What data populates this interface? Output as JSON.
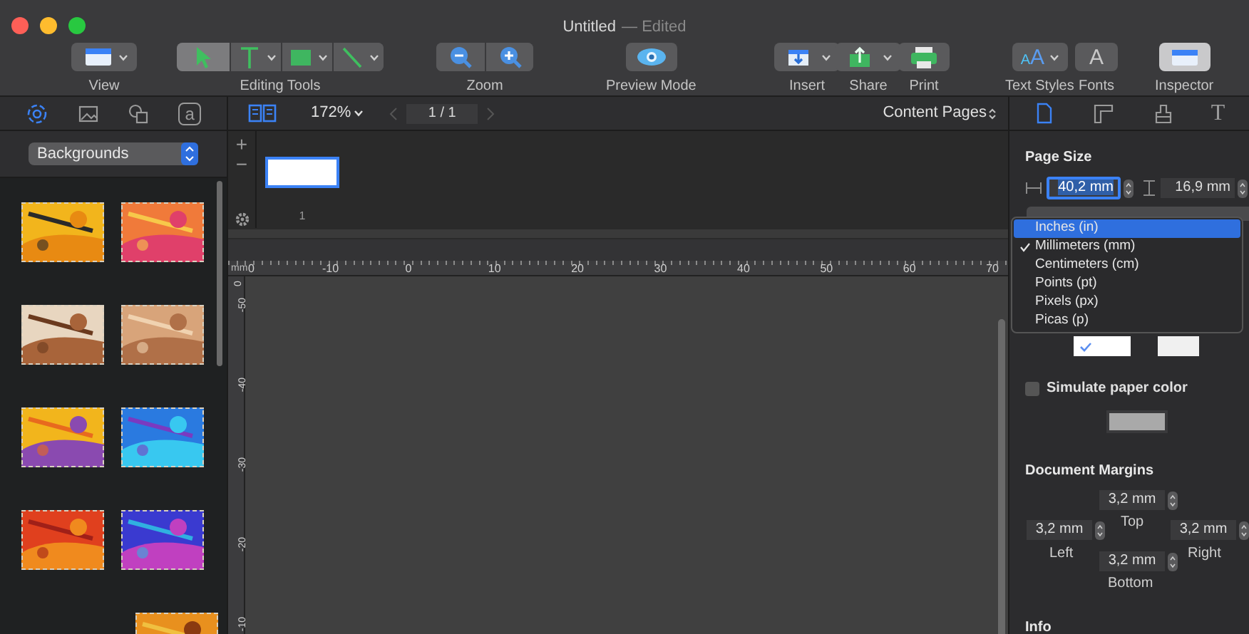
{
  "window": {
    "title": "Untitled",
    "subtitle": "— Edited"
  },
  "toolbar": [
    {
      "kind": "button",
      "label": "View",
      "menu": true,
      "selected": false
    },
    {
      "kind": "segmented",
      "label": "Editing Tools",
      "segments": [
        {
          "menu": false,
          "selected": true
        },
        {
          "menu": true,
          "selected": false
        },
        {
          "menu": true,
          "selected": false
        },
        {
          "menu": true,
          "selected": false
        }
      ]
    },
    {
      "kind": "segmented",
      "label": "Zoom",
      "segments": [
        {
          "menu": false,
          "selected": false
        },
        {
          "menu": false,
          "selected": false
        }
      ]
    },
    {
      "kind": "button",
      "label": "Preview Mode",
      "menu": false,
      "selected": false
    },
    {
      "kind": "button",
      "label": "Insert",
      "menu": true,
      "selected": false
    },
    {
      "kind": "button",
      "label": "Share",
      "menu": true,
      "selected": false
    },
    {
      "kind": "button",
      "label": "Print",
      "menu": false,
      "selected": false
    },
    {
      "kind": "button",
      "label": "Text Styles",
      "menu": true,
      "selected": false,
      "glyphs": [
        "A",
        "A"
      ]
    },
    {
      "kind": "button",
      "label": "Fonts",
      "menu": false,
      "selected": false,
      "glyphs": [
        "A"
      ]
    },
    {
      "kind": "button",
      "label": "Inspector",
      "menu": false,
      "selected": true
    }
  ],
  "library": {
    "tabs": [
      {
        "selected": true
      },
      {
        "selected": false
      },
      {
        "selected": false
      },
      {
        "selected": false,
        "glyph": "a"
      }
    ],
    "category": "Backgrounds"
  },
  "canvas_bar": {
    "zoom": "172%",
    "page": "1 / 1",
    "pages_menu": "Content Pages"
  },
  "page_strip": {
    "add": "+",
    "remove": "−",
    "pages": [
      {
        "number": "1",
        "selected": true
      }
    ]
  },
  "rulers": {
    "unit": "mm",
    "horizontal": [
      "0",
      "-10",
      "0",
      "10",
      "20",
      "30",
      "40",
      "50",
      "60",
      "70"
    ],
    "vertical": [
      "0",
      "-50",
      "-40",
      "-30",
      "-20",
      "-10"
    ]
  },
  "inspector": {
    "tabs": [
      {
        "selected": true
      },
      {
        "selected": false
      },
      {
        "selected": false
      },
      {
        "selected": false,
        "glyph": "T"
      }
    ],
    "page_size": {
      "title": "Page Size",
      "width": "40,2 mm",
      "height": "16,9 mm"
    },
    "unit_menu": [
      {
        "label": "Inches (in)",
        "selected": true,
        "checked": false
      },
      {
        "label": "Millimeters (mm)",
        "selected": false,
        "checked": true
      },
      {
        "label": "Centimeters (cm)",
        "selected": false,
        "checked": false
      },
      {
        "label": "Points (pt)",
        "selected": false,
        "checked": false
      },
      {
        "label": "Pixels (px)",
        "selected": false,
        "checked": false
      },
      {
        "label": "Picas (p)",
        "selected": false,
        "checked": false
      }
    ],
    "orientation": [
      {
        "selected": true
      },
      {
        "selected": false
      }
    ],
    "simulate_paper": {
      "label": "Simulate paper color",
      "checked": false,
      "color": "#a9a9a9"
    },
    "margins": {
      "title": "Document Margins",
      "top": {
        "value": "3,2 mm",
        "label": "Top"
      },
      "left": {
        "value": "3,2 mm",
        "label": "Left"
      },
      "right": {
        "value": "3,2 mm",
        "label": "Right"
      },
      "bottom": {
        "value": "3,2 mm",
        "label": "Bottom"
      }
    },
    "info": {
      "title": "Info"
    }
  }
}
